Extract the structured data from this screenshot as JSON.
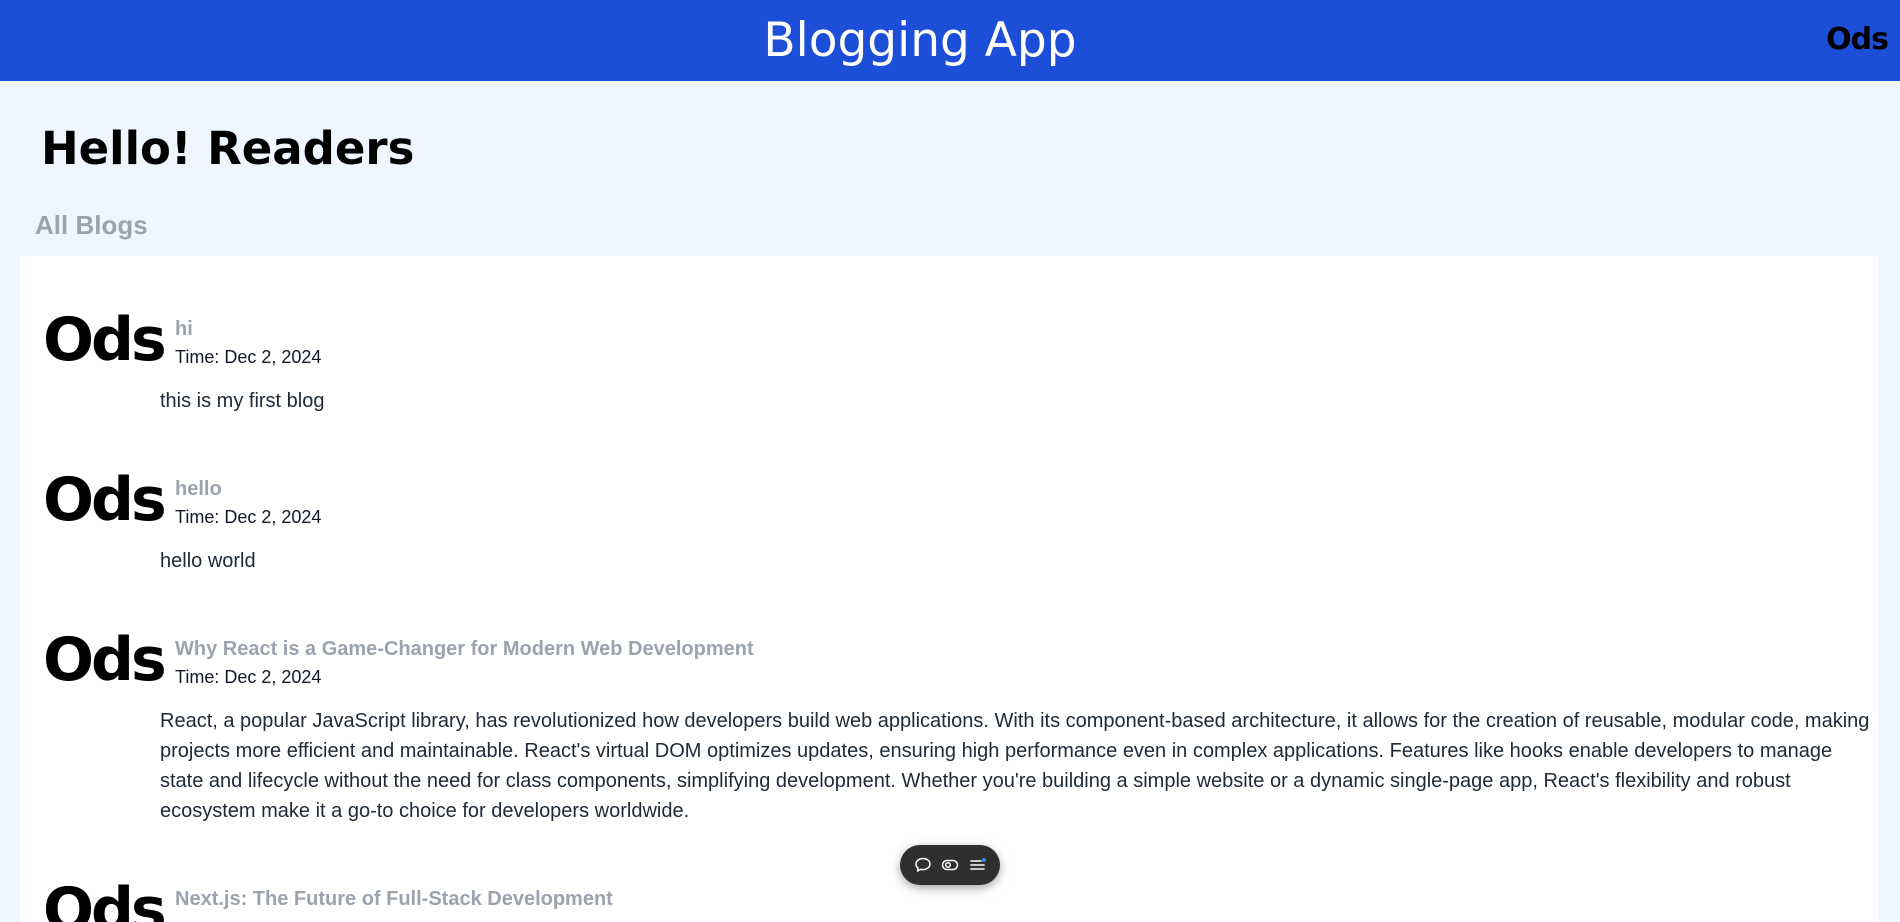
{
  "navbar": {
    "title": "Blogging App",
    "avatar_text": "Ods"
  },
  "greeting": "Hello! Readers",
  "section_title": "All Blogs",
  "time_prefix": "Time:",
  "blogs": [
    {
      "avatar_text": "Ods",
      "title": "hi",
      "time": "Time: Dec 2, 2024",
      "body": "this is my first blog"
    },
    {
      "avatar_text": "Ods",
      "title": "hello",
      "time": "Time: Dec 2, 2024",
      "body": "hello world"
    },
    {
      "avatar_text": "Ods",
      "title": "Why React is a Game-Changer for Modern Web Development",
      "time": "Time: Dec 2, 2024",
      "body": "React, a popular JavaScript library, has revolutionized how developers build web applications. With its component-based architecture, it allows for the creation of reusable, modular code, making projects more efficient and maintainable. React's virtual DOM optimizes updates, ensuring high performance even in complex applications. Features like hooks enable developers to manage state and lifecycle without the need for class components, simplifying development. Whether you're building a simple website or a dynamic single-page app, React's flexibility and robust ecosystem make it a go-to choice for developers worldwide."
    },
    {
      "avatar_text": "Ods",
      "title": "Next.js: The Future of Full-Stack Development",
      "time": "",
      "body": ""
    }
  ],
  "toolbar": {
    "icons": [
      "comment-icon",
      "toggle-icon",
      "menu-list-icon"
    ],
    "icon_color": "#ffffff",
    "accent_color": "#3b82f6"
  },
  "colors": {
    "navbar_bg": "#1d4ed8",
    "page_bg": "#eff6ff",
    "panel_bg": "#ffffff",
    "muted_title": "#9ca3af"
  }
}
